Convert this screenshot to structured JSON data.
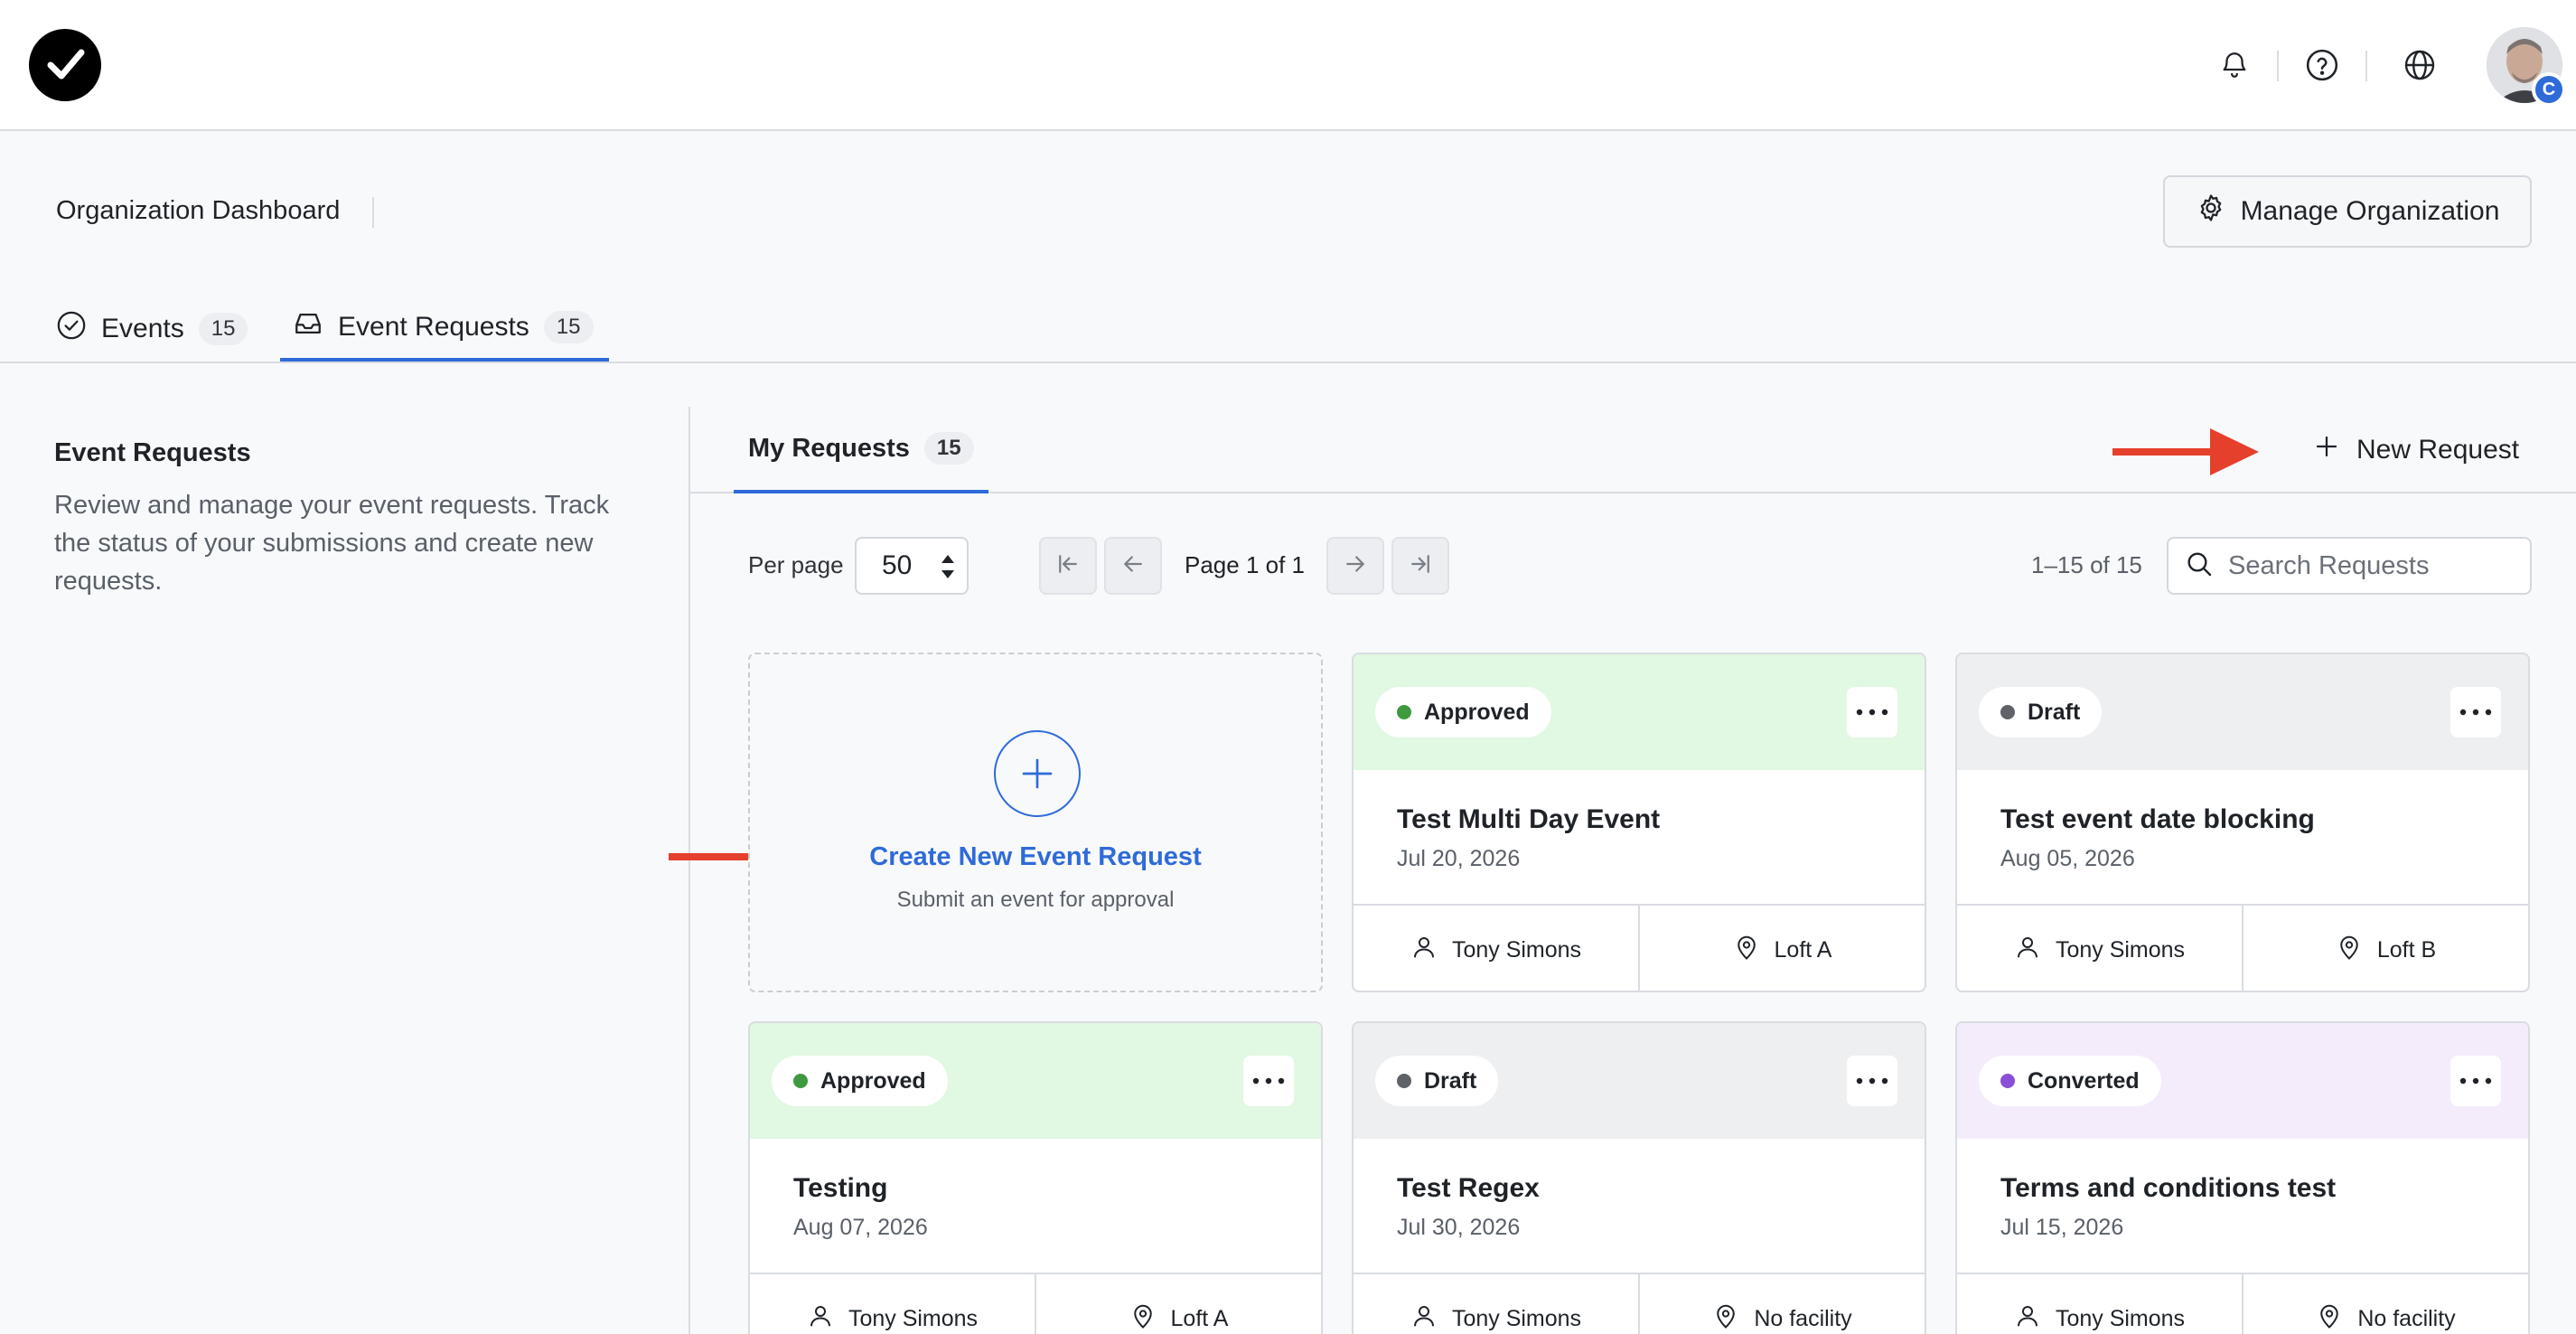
{
  "header": {
    "icons": [
      "bell-icon",
      "help-icon",
      "globe-icon"
    ],
    "avatar_badge": "C"
  },
  "page": {
    "title": "Organization Dashboard",
    "manage_button": "Manage Organization"
  },
  "main_tabs": [
    {
      "label": "Events",
      "count": "15",
      "icon": "check-circle-icon"
    },
    {
      "label": "Event Requests",
      "count": "15",
      "icon": "inbox-icon",
      "active": true
    }
  ],
  "sidebar": {
    "title": "Event Requests",
    "description": "Review and manage your event requests. Track the status of your submissions and create new requests."
  },
  "sub_tabs": [
    {
      "label": "My Requests",
      "count": "15",
      "active": true
    }
  ],
  "new_request_label": "New Request",
  "toolbar": {
    "per_page_label": "Per page",
    "per_page_value": "50",
    "page_text": "Page 1 of 1",
    "range_text": "1–15 of 15",
    "search_placeholder": "Search Requests"
  },
  "create_card": {
    "title": "Create New Event Request",
    "subtitle": "Submit an event for approval"
  },
  "cards": [
    {
      "status": "Approved",
      "status_color": "#3f9a3f",
      "title": "Test Multi Day Event",
      "date": "Jul 20, 2026",
      "requester": "Tony Simons",
      "location": "Loft A"
    },
    {
      "status": "Draft",
      "status_color": "#5f6368",
      "title": "Test event date blocking",
      "date": "Aug 05, 2026",
      "requester": "Tony Simons",
      "location": "Loft B"
    },
    {
      "status": "Approved",
      "status_color": "#3f9a3f",
      "title": "Testing",
      "date": "Aug 07, 2026",
      "requester": "Tony Simons",
      "location": "Loft A"
    },
    {
      "status": "Draft",
      "status_color": "#5f6368",
      "title": "Test Regex",
      "date": "Jul 30, 2026",
      "requester": "Tony Simons",
      "location": "No facility"
    },
    {
      "status": "Converted",
      "status_color": "#8a4fd6",
      "title": "Terms and conditions test",
      "date": "Jul 15, 2026",
      "requester": "Tony Simons",
      "location": "No facility"
    }
  ],
  "colors": {
    "accent": "#2f6bd8",
    "annotation_arrow": "#e5402b",
    "approved_bg": "#e1f8e3",
    "draft_bg": "#eeeff1",
    "converted_bg": "#f4ecfb"
  }
}
